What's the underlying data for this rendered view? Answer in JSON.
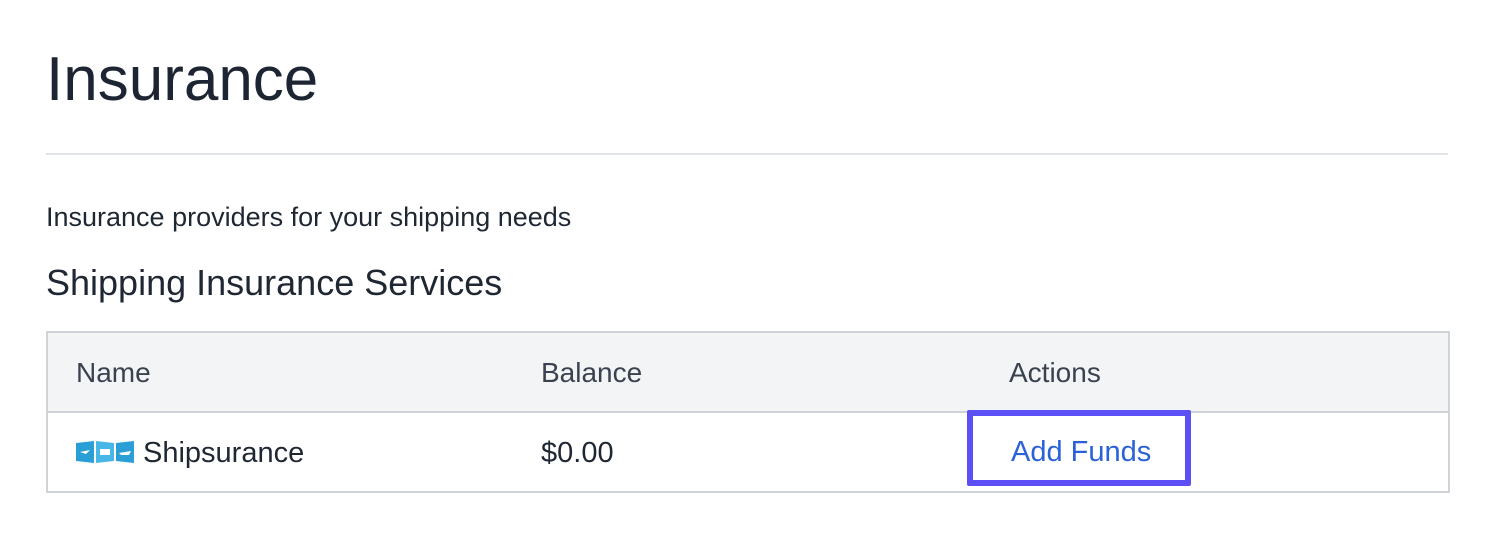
{
  "page": {
    "title": "Insurance",
    "description": "Insurance providers for your shipping needs",
    "section_title": "Shipping Insurance Services"
  },
  "table": {
    "columns": [
      "Name",
      "Balance",
      "Actions"
    ],
    "rows": [
      {
        "logo_icon": "shipsurance-logo-icon",
        "name": "Shipsurance",
        "balance": "$0.00",
        "action_label": "Add Funds"
      }
    ]
  },
  "colors": {
    "link": "#2b62d9",
    "focus_outline": "#5b4ff5",
    "header_background": "#f3f4f6",
    "logo_blue": "#2a9fd6"
  }
}
